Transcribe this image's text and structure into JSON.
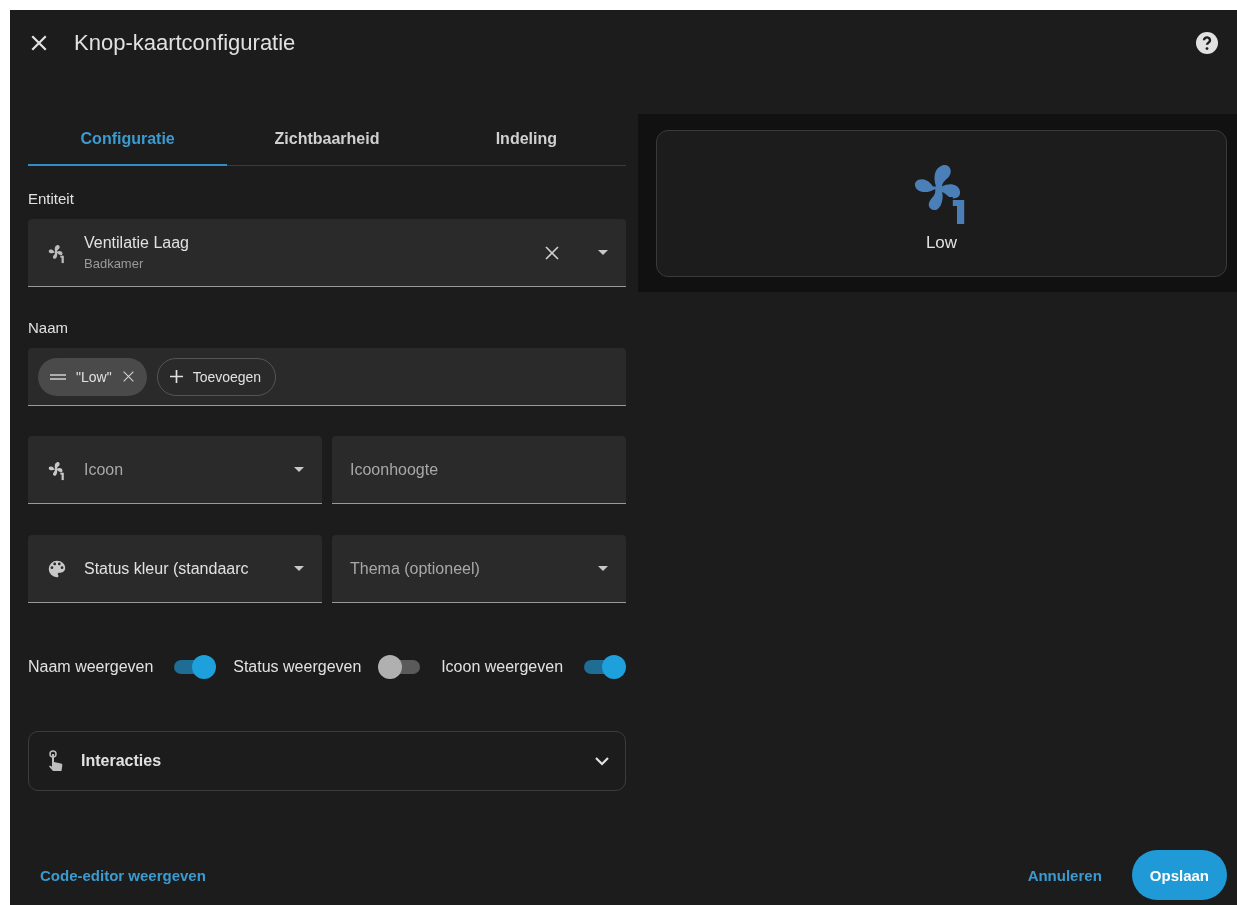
{
  "dialog": {
    "title": "Knop-kaartconfiguratie"
  },
  "tabs": [
    {
      "label": "Configuratie",
      "selected": true
    },
    {
      "label": "Zichtbaarheid",
      "selected": false
    },
    {
      "label": "Indeling",
      "selected": false
    }
  ],
  "entity": {
    "label": "Entiteit",
    "value": "Ventilatie Laag",
    "secondary": "Badkamer"
  },
  "name": {
    "label": "Naam",
    "chips": [
      {
        "text": "\"Low\""
      }
    ],
    "add_button": "Toevoegen"
  },
  "fields": [
    {
      "kind": "icon_select",
      "placeholder": "Icoon"
    },
    {
      "kind": "input",
      "placeholder": "Icoonhoogte"
    },
    {
      "kind": "color_select",
      "value": "Status kleur (standaarc"
    },
    {
      "kind": "select",
      "placeholder": "Thema (optioneel)"
    }
  ],
  "toggles": [
    {
      "label": "Naam weergeven",
      "on": true
    },
    {
      "label": "Status weergeven",
      "on": false
    },
    {
      "label": "Icoon weergeven",
      "on": true
    }
  ],
  "expander": {
    "title": "Interacties",
    "expanded": false
  },
  "footer": {
    "link": "Code-editor weergeven",
    "cancel": "Annuleren",
    "save": "Opslaan"
  },
  "preview": {
    "state": "Low"
  }
}
